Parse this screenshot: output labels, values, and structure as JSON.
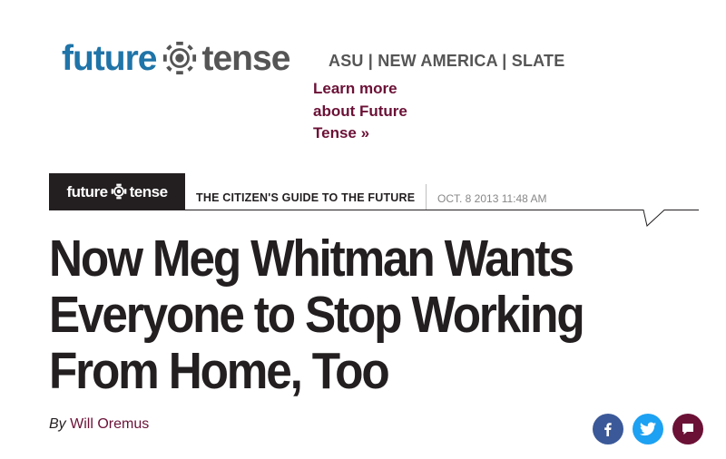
{
  "header": {
    "logo_word1": "future",
    "logo_word2": "tense",
    "partners": "ASU | NEW AMERICA | SLATE",
    "learn_more": "Learn more about Future Tense »"
  },
  "section": {
    "badge_word1": "future",
    "badge_word2": "tense",
    "guide": "THE CITIZEN'S GUIDE TO THE FUTURE",
    "date": "OCT. 8 2013 11:48 AM"
  },
  "article": {
    "headline": "Now Meg Whitman Wants Everyone to Stop Working From Home, Too",
    "byline_prefix": "By",
    "author": "Will Oremus"
  },
  "share": {
    "icons": [
      "facebook-icon",
      "twitter-icon",
      "comment-icon"
    ]
  },
  "colors": {
    "logo_blue": "#1f74a8",
    "logo_gray": "#555555",
    "accent_maroon": "#6b1136",
    "badge_black": "#231f20",
    "facebook": "#3b5998",
    "twitter": "#1da1f2"
  }
}
